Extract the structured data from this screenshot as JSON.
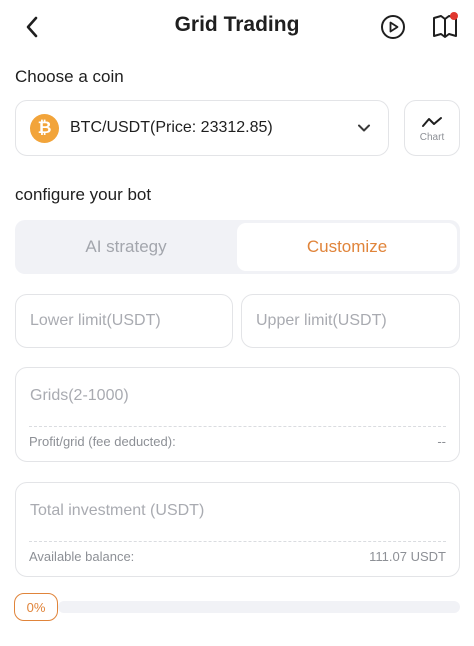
{
  "header": {
    "title": "Grid Trading",
    "icons": [
      "chevron-left-icon",
      "play-circle-icon",
      "book-icon"
    ],
    "has_notification_dot": true
  },
  "coin_section": {
    "label": "Choose a coin",
    "selected_coin": "BTC/USDT(Price: 23312.85)",
    "coin_icon_glyph": "₿",
    "chart_button_label": "Chart"
  },
  "bot_section": {
    "label": "configure your bot",
    "tabs": [
      {
        "label": "AI strategy",
        "active": false
      },
      {
        "label": "Customize",
        "active": true
      }
    ]
  },
  "inputs": {
    "lower_limit_placeholder": "Lower limit(USDT)",
    "upper_limit_placeholder": "Upper limit(USDT)",
    "grids_placeholder": "Grids(2-1000)",
    "profit_label": "Profit/grid (fee deducted):",
    "profit_value": "--",
    "investment_placeholder": "Total investment (USDT)",
    "balance_label": "Available balance:",
    "balance_value": "111.07 USDT"
  },
  "progress": {
    "label": "0%",
    "value": 0
  },
  "colors": {
    "accent": "#e0843a",
    "bitcoin": "#f2a43a",
    "notification": "#e0372f"
  }
}
